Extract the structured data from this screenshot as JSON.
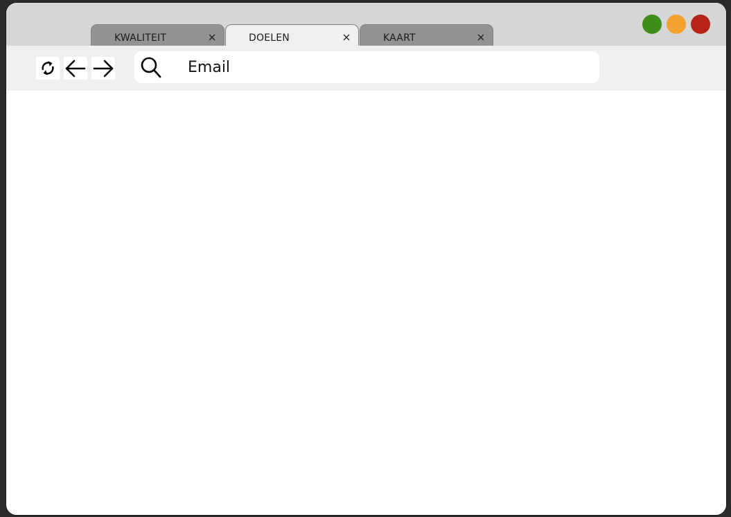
{
  "tabs": [
    {
      "label": "KWALITEIT",
      "active": false,
      "close_icon": "close-icon"
    },
    {
      "label": "DOELEN",
      "active": true,
      "close_icon": "close-icon"
    },
    {
      "label": "KAART",
      "active": false,
      "close_icon": "close-icon"
    }
  ],
  "window_controls": {
    "colors": {
      "green": "#3f8e1b",
      "orange": "#f2a22e",
      "red": "#b5231a"
    }
  },
  "toolbar": {
    "icons": [
      "refresh-icon",
      "arrow-left-icon",
      "arrow-right-icon"
    ],
    "address_value": "Email",
    "search_icon": "search-icon"
  }
}
